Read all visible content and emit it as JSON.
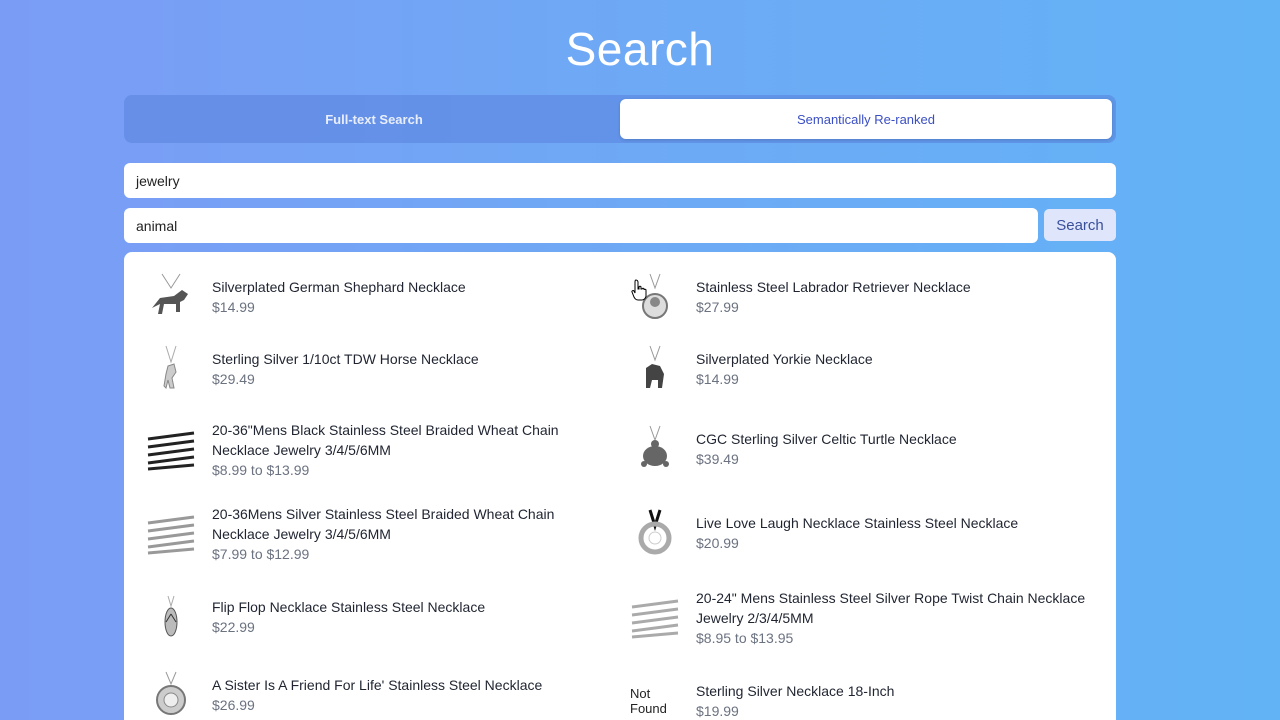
{
  "page": {
    "title": "Search"
  },
  "tabs": [
    {
      "label": "Full-text Search",
      "active": false
    },
    {
      "label": "Semantically Re-ranked",
      "active": true
    }
  ],
  "search": {
    "primary_query": "jewelry",
    "secondary_query": "animal",
    "button_label": "Search"
  },
  "results": [
    {
      "name": "Silverplated German Shephard Necklace",
      "price": "$14.99",
      "icon": "dog-pendant-icon"
    },
    {
      "name": "Stainless Steel Labrador Retriever Necklace",
      "price": "$27.99",
      "icon": "dog-pendant-icon"
    },
    {
      "name": "Sterling Silver 1/10ct TDW Horse Necklace",
      "price": "$29.49",
      "icon": "horse-pendant-icon"
    },
    {
      "name": "Silverplated Yorkie Necklace",
      "price": "$14.99",
      "icon": "dog-pendant-icon"
    },
    {
      "name": "20-36\"Mens Black Stainless Steel Braided Wheat Chain Necklace Jewelry 3/4/5/6MM",
      "price": "$8.99 to $13.99",
      "icon": "chain-icon"
    },
    {
      "name": "CGC Sterling Silver Celtic Turtle Necklace",
      "price": "$39.49",
      "icon": "turtle-pendant-icon"
    },
    {
      "name": "20-36Mens Silver Stainless Steel Braided Wheat Chain Necklace Jewelry 3/4/5/6MM",
      "price": "$7.99 to $12.99",
      "icon": "chain-icon"
    },
    {
      "name": "Live Love Laugh Necklace Stainless Steel Necklace",
      "price": "$20.99",
      "icon": "ring-pendant-icon"
    },
    {
      "name": "Flip Flop Necklace Stainless Steel Necklace",
      "price": "$22.99",
      "icon": "flip-flop-pendant-icon"
    },
    {
      "name": "20-24\" Mens Stainless Steel Silver Rope Twist Chain Necklace Jewelry 2/3/4/5MM",
      "price": "$8.95 to $13.95",
      "icon": "chain-icon"
    },
    {
      "name": "A Sister Is A Friend For Life' Stainless Steel Necklace",
      "price": "$26.99",
      "icon": "locket-pendant-icon"
    },
    {
      "name": "Sterling Silver Necklace 18-Inch",
      "price": "$19.99",
      "icon": "broken-image-icon",
      "image_alt": "Not Found"
    }
  ]
}
